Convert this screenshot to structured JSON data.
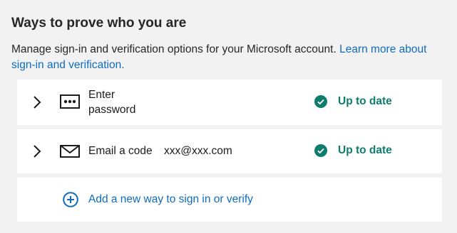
{
  "section": {
    "title": "Ways to prove who you are",
    "description": "Manage sign-in and verification options for your Microsoft account.",
    "learn_more_link": "Learn more about sign-in and verification."
  },
  "methods": [
    {
      "label": "Enter password",
      "detail": "",
      "icon": "password-icon",
      "status": "Up to date"
    },
    {
      "label": "Email a code",
      "detail": "xxx@xxx.com",
      "icon": "email-icon",
      "status": "Up to date"
    }
  ],
  "add_method": {
    "label": "Add a new way to sign in or verify",
    "icon": "plus-circle-icon"
  },
  "colors": {
    "background": "#f2f2f2",
    "card": "#ffffff",
    "link": "#0f6cbd",
    "success": "#107c6d"
  }
}
